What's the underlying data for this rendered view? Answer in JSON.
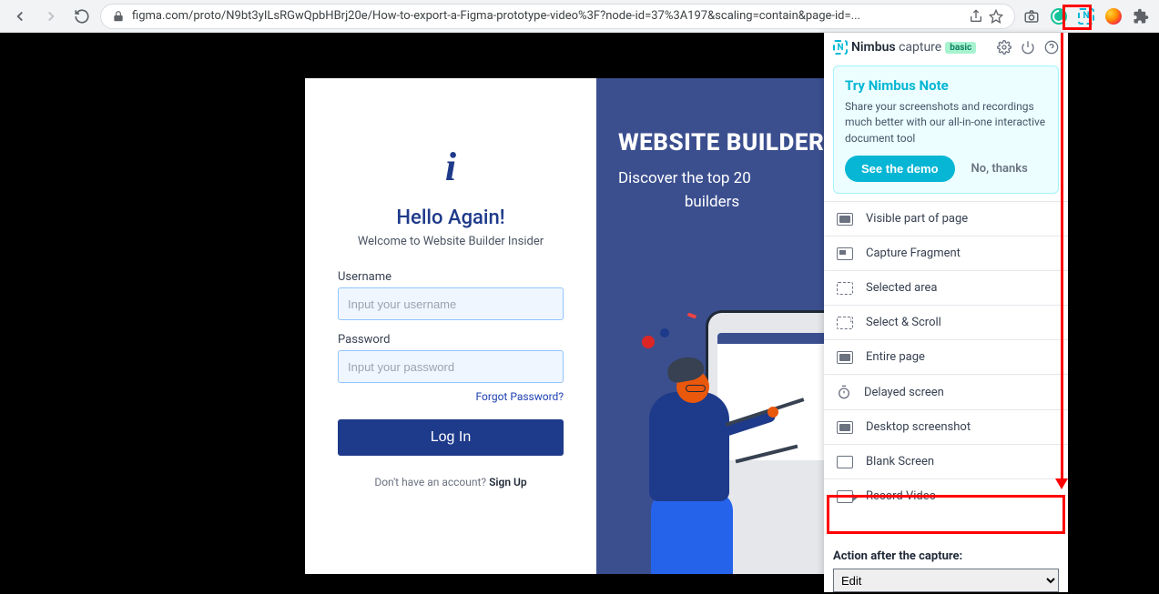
{
  "browser": {
    "url": "figma.com/proto/N9bt3yILsRGwQpbHBrj20e/How-to-export-a-Figma-prototype-video%3F?node-id=37%3A197&scaling=contain&page-id=..."
  },
  "login": {
    "hello": "Hello Again!",
    "welcome": "Welcome to Website Builder Insider",
    "username_label": "Username",
    "username_placeholder": "Input your username",
    "password_label": "Password",
    "password_placeholder": "Input your password",
    "forgot": "Forgot Password?",
    "login_btn": "Log In",
    "noacct": "Don't have an account? ",
    "signup": "Sign Up"
  },
  "hero": {
    "title": "WEBSITE BUILDER",
    "line1": "Discover the top 20",
    "line2": "builders"
  },
  "nimbus": {
    "brand_bold": "Nimbus",
    "brand_light": " capture",
    "badge": "basic",
    "promo_title": "Try Nimbus Note",
    "promo_text": "Share your screenshots and recordings much better with our all-in-one interactive document tool",
    "demo": "See the demo",
    "no_thanks": "No, thanks",
    "options": [
      "Visible part of page",
      "Capture Fragment",
      "Selected area",
      "Select & Scroll",
      "Entire page",
      "Delayed screen",
      "Desktop screenshot",
      "Blank Screen",
      "Record Video"
    ],
    "action_label": "Action after the capture:",
    "action_value": "Edit"
  }
}
